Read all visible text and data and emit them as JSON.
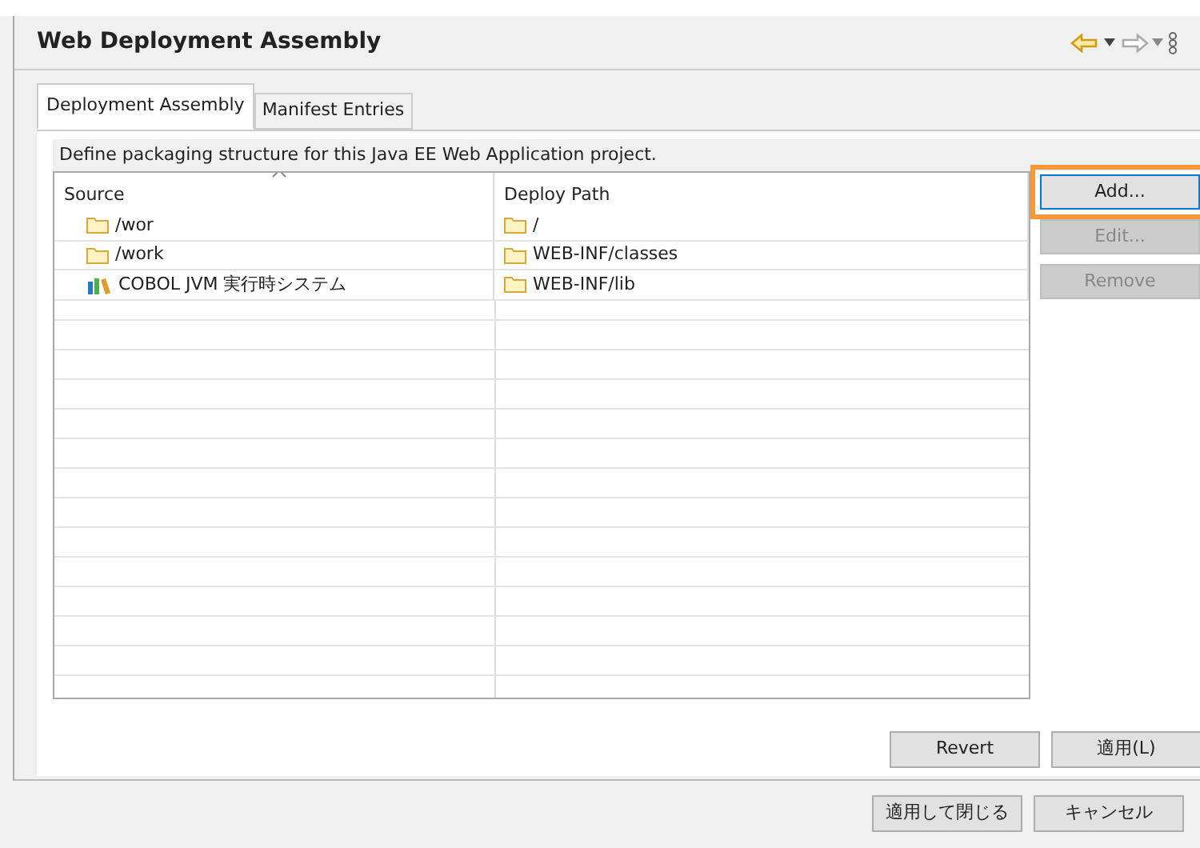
{
  "header": {
    "title": "Web Deployment Assembly"
  },
  "tabs": [
    {
      "label": "Deployment Assembly",
      "selected": true
    },
    {
      "label": "Manifest Entries",
      "selected": false
    }
  ],
  "description": "Define packaging structure for this Java EE Web Application project.",
  "table": {
    "columns": [
      "Source",
      "Deploy Path"
    ],
    "rows": [
      {
        "source": "/wor",
        "kind": "folder",
        "deploy_path": "/"
      },
      {
        "source": "/work",
        "kind": "folder",
        "deploy_path": "WEB-INF/classes"
      },
      {
        "source": "COBOL JVM 実行時システム",
        "kind": "library",
        "deploy_path": "WEB-INF/lib"
      }
    ]
  },
  "side_buttons": [
    {
      "label": "Add...",
      "disabled": false,
      "highlighted": true
    },
    {
      "label": "Edit...",
      "disabled": true,
      "highlighted": false
    },
    {
      "label": "Remove",
      "disabled": true,
      "highlighted": false
    }
  ],
  "panel_buttons": [
    "Revert",
    "適用(L)"
  ],
  "dialog_buttons": [
    "適用して閉じる",
    "キャンセル"
  ]
}
